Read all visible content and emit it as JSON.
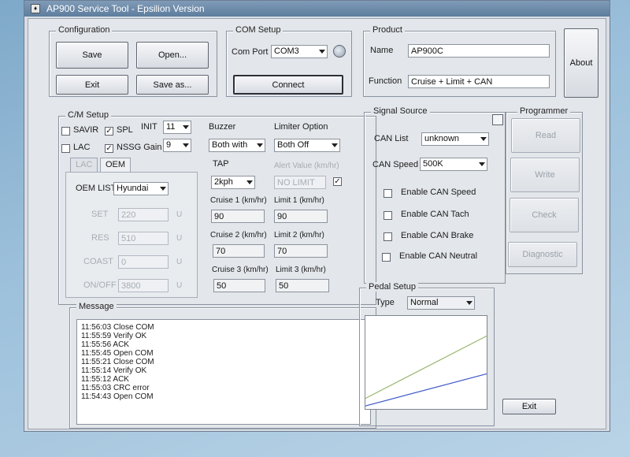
{
  "window": {
    "title": "AP900 Service Tool - Epsilion Version",
    "icon": "app-icon"
  },
  "configuration": {
    "legend": "Configuration",
    "save": "Save",
    "open": "Open...",
    "exit": "Exit",
    "save_as": "Save as..."
  },
  "com_setup": {
    "legend": "COM Setup",
    "port_label": "Com Port",
    "port_value": "COM3",
    "connect": "Connect"
  },
  "product": {
    "legend": "Product",
    "name_label": "Name",
    "name_value": "AP900C",
    "function_label": "Function",
    "function_value": "Cruise + Limit + CAN"
  },
  "about": "About",
  "cm_setup": {
    "legend": "C/M Setup",
    "savir": "SAVIR",
    "spl": "SPL",
    "init_label": "INIT",
    "init_value": "11",
    "lac": "LAC",
    "nssg_gain": "NSSG Gain",
    "nssg_value": "9",
    "tab_lac": "LAC",
    "tab_oem": "OEM",
    "oem_list_label": "OEM LIST",
    "oem_list_value": "Hyundai",
    "set_label": "SET",
    "set_value": "220",
    "res_label": "RES",
    "res_value": "510",
    "coast_label": "COAST",
    "coast_value": "0",
    "onoff_label": "ON/OFF",
    "onoff_value": "3800",
    "unit": "U",
    "buzzer_label": "Buzzer",
    "buzzer_value": "Both with",
    "limiter_label": "Limiter Option",
    "limiter_value": "Both Off",
    "tap_label": "TAP",
    "tap_value": "2kph",
    "alert_label": "Alert Value (km/hr)",
    "alert_value": "NO LIMIT",
    "cruise1_label": "Cruise 1 (km/hr)",
    "cruise1_value": "90",
    "limit1_label": "Limit 1 (km/hr)",
    "limit1_value": "90",
    "cruise2_label": "Cruise 2 (km/hr)",
    "cruise2_value": "70",
    "limit2_label": "Limit 2 (km/hr)",
    "limit2_value": "70",
    "cruise3_label": "Cruise 3 (km/hr)",
    "cruise3_value": "50",
    "limit3_label": "Limit 3 (km/hr)",
    "limit3_value": "50"
  },
  "signal_source": {
    "legend": "Signal Source",
    "can_list_label": "CAN List",
    "can_list_value": "unknown",
    "can_speed_label": "CAN Speed",
    "can_speed_value": "500K",
    "enable_speed": "Enable CAN Speed",
    "enable_tach": "Enable CAN Tach",
    "enable_brake": "Enable CAN Brake",
    "enable_neutral": "Enable CAN Neutral"
  },
  "programmer": {
    "legend": "Programmer",
    "read": "Read",
    "write": "Write",
    "check": "Check",
    "diagnostic": "Diagnostic"
  },
  "message": {
    "legend": "Message",
    "lines": [
      "11:56:03 Close COM",
      "11:55:59 Verify OK",
      "11:55:56 ACK",
      "11:55:45 Open COM",
      "11:55:21 Close COM",
      "11:55:14 Verify OK",
      "11:55:12 ACK",
      "11:55:03 CRC error",
      "11:54:43 Open COM"
    ]
  },
  "pedal_setup": {
    "legend": "Pedal Setup",
    "type_label": "Type",
    "type_value": "Normal",
    "line_colors": [
      "#9ab56a",
      "#3c57c8"
    ],
    "upper_line_level": [
      0.12,
      0.78
    ],
    "lower_line_level": [
      0.04,
      0.38
    ]
  },
  "exit_button": "Exit"
}
